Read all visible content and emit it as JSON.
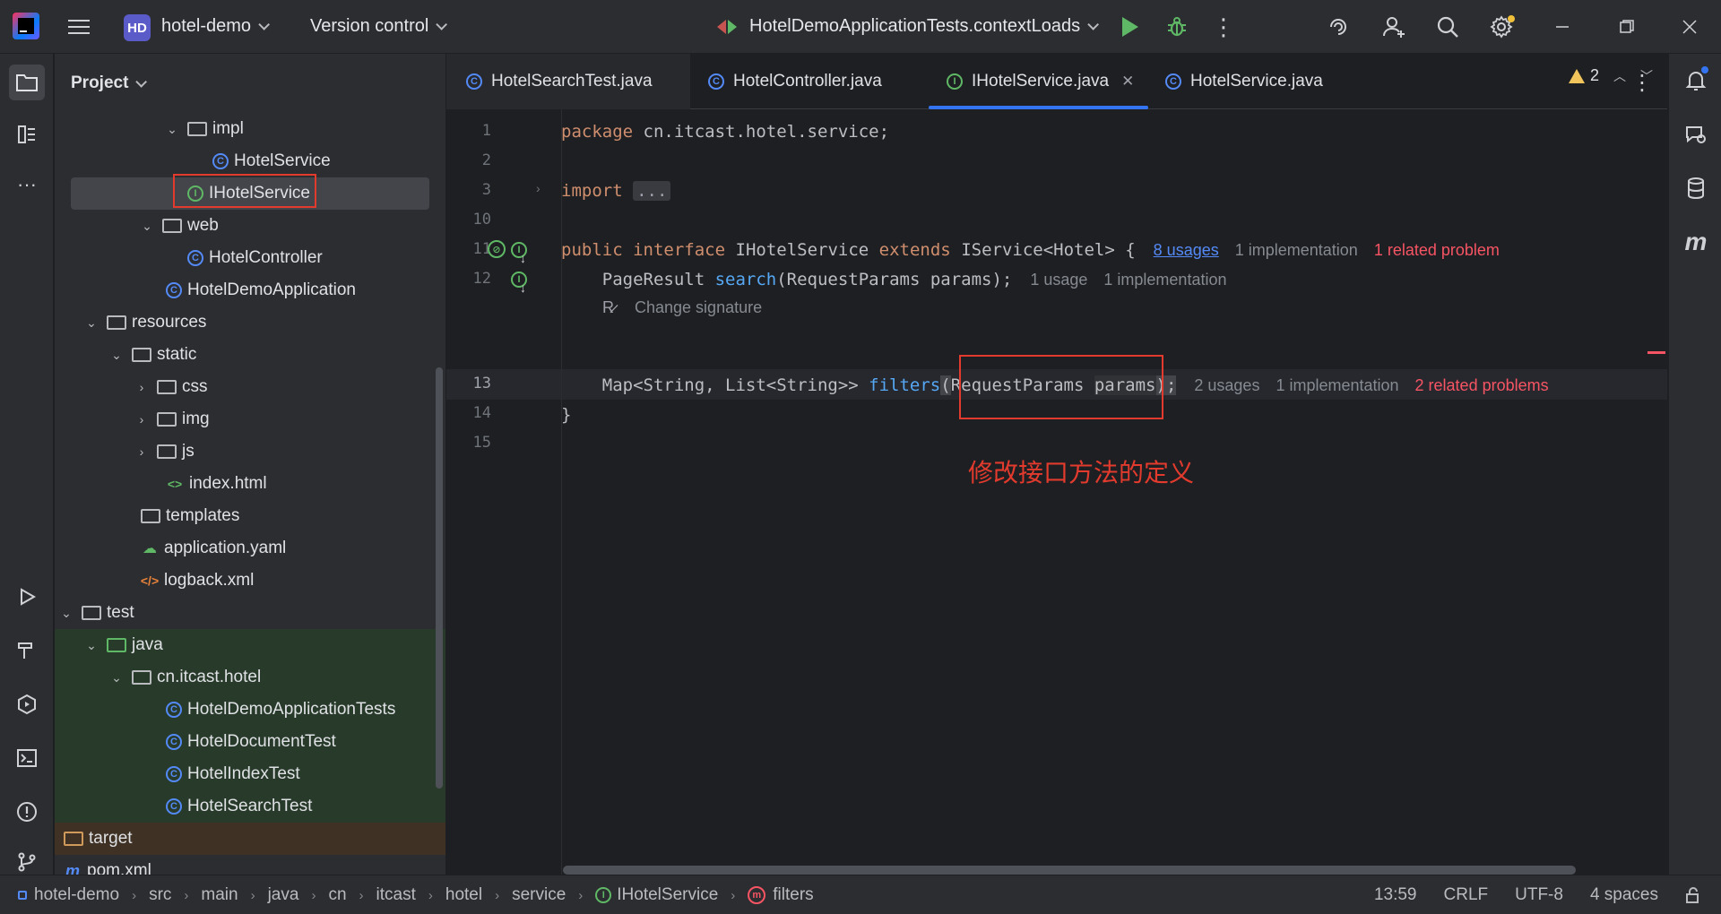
{
  "titlebar": {
    "project_badge": "HD",
    "project_name": "hotel-demo",
    "version_control": "Version control",
    "run_config": "HotelDemoApplicationTests.contextLoads"
  },
  "project_panel": {
    "title": "Project",
    "rows": [
      {
        "label": "impl",
        "icon": "package-folder-icon"
      },
      {
        "label": "HotelService",
        "icon": "class-icon"
      },
      {
        "label": "IHotelService",
        "icon": "interface-icon"
      },
      {
        "label": "web",
        "icon": "package-folder-icon"
      },
      {
        "label": "HotelController",
        "icon": "class-icon"
      },
      {
        "label": "HotelDemoApplication",
        "icon": "spring-class-icon"
      },
      {
        "label": "resources",
        "icon": "resources-folder-icon"
      },
      {
        "label": "static",
        "icon": "folder-icon"
      },
      {
        "label": "css",
        "icon": "folder-icon"
      },
      {
        "label": "img",
        "icon": "folder-icon"
      },
      {
        "label": "js",
        "icon": "folder-icon"
      },
      {
        "label": "index.html",
        "icon": "html-file-icon"
      },
      {
        "label": "templates",
        "icon": "folder-icon"
      },
      {
        "label": "application.yaml",
        "icon": "yaml-file-icon"
      },
      {
        "label": "logback.xml",
        "icon": "xml-file-icon"
      },
      {
        "label": "test",
        "icon": "folder-icon"
      },
      {
        "label": "java",
        "icon": "test-source-folder-icon"
      },
      {
        "label": "cn.itcast.hotel",
        "icon": "package-folder-icon"
      },
      {
        "label": "HotelDemoApplicationTests",
        "icon": "test-class-icon"
      },
      {
        "label": "HotelDocumentTest",
        "icon": "test-class-icon"
      },
      {
        "label": "HotelIndexTest",
        "icon": "test-class-icon"
      },
      {
        "label": "HotelSearchTest",
        "icon": "test-class-icon"
      },
      {
        "label": "target",
        "icon": "excluded-folder-icon"
      },
      {
        "label": "pom.xml",
        "icon": "maven-icon"
      }
    ]
  },
  "tabs": [
    {
      "label": "HotelSearchTest.java"
    },
    {
      "label": "HotelController.java"
    },
    {
      "label": "IHotelService.java",
      "active": true
    },
    {
      "label": "HotelService.java"
    }
  ],
  "editor": {
    "line_numbers": [
      "1",
      "2",
      "3",
      "10",
      "11",
      "12",
      "13",
      "14",
      "15"
    ],
    "warnings_count": "2",
    "code": {
      "l1_kw": "package",
      "l1_rest": " cn.itcast.hotel.service;",
      "l3_kw": "import",
      "l3_fold": "...",
      "l11_kw1": "public",
      "l11_kw2": "interface",
      "l11_name": "IHotelService",
      "l11_kw3": "extends",
      "l11_rest": "IService<Hotel> {",
      "l11_hint_usages": "8 usages",
      "l11_hint_impl": "1 implementation",
      "l11_hint_problem": "1 related problem",
      "l12_type": "    PageResult ",
      "l12_fn": "search",
      "l12_rest": "(RequestParams params);",
      "l12_hint_usages": "1 usage",
      "l12_hint_impl": "1 implementation",
      "change_signature": "Change signature",
      "l13_type": "    Map<String, List<String>> ",
      "l13_fn": "filters",
      "l13_open": "(",
      "l13_params_type": "RequestParams ",
      "l13_param": "params",
      "l13_close": ");",
      "l13_hint_usages": "2 usages",
      "l13_hint_impl": "1 implementation",
      "l13_hint_problems": "2 related problems",
      "l14": "}"
    },
    "annotation": "修改接口方法的定义"
  },
  "statusbar": {
    "breadcrumbs": [
      "hotel-demo",
      "src",
      "main",
      "java",
      "cn",
      "itcast",
      "hotel",
      "service",
      "IHotelService",
      "filters"
    ],
    "position": "13:59",
    "line_ending": "CRLF",
    "encoding": "UTF-8",
    "indent": "4 spaces"
  },
  "colors": {
    "accent": "#3574f0",
    "annotation_red": "#e23b2e",
    "keyword": "#cf8e6d",
    "function": "#56a8f5",
    "error": "#f75464"
  }
}
